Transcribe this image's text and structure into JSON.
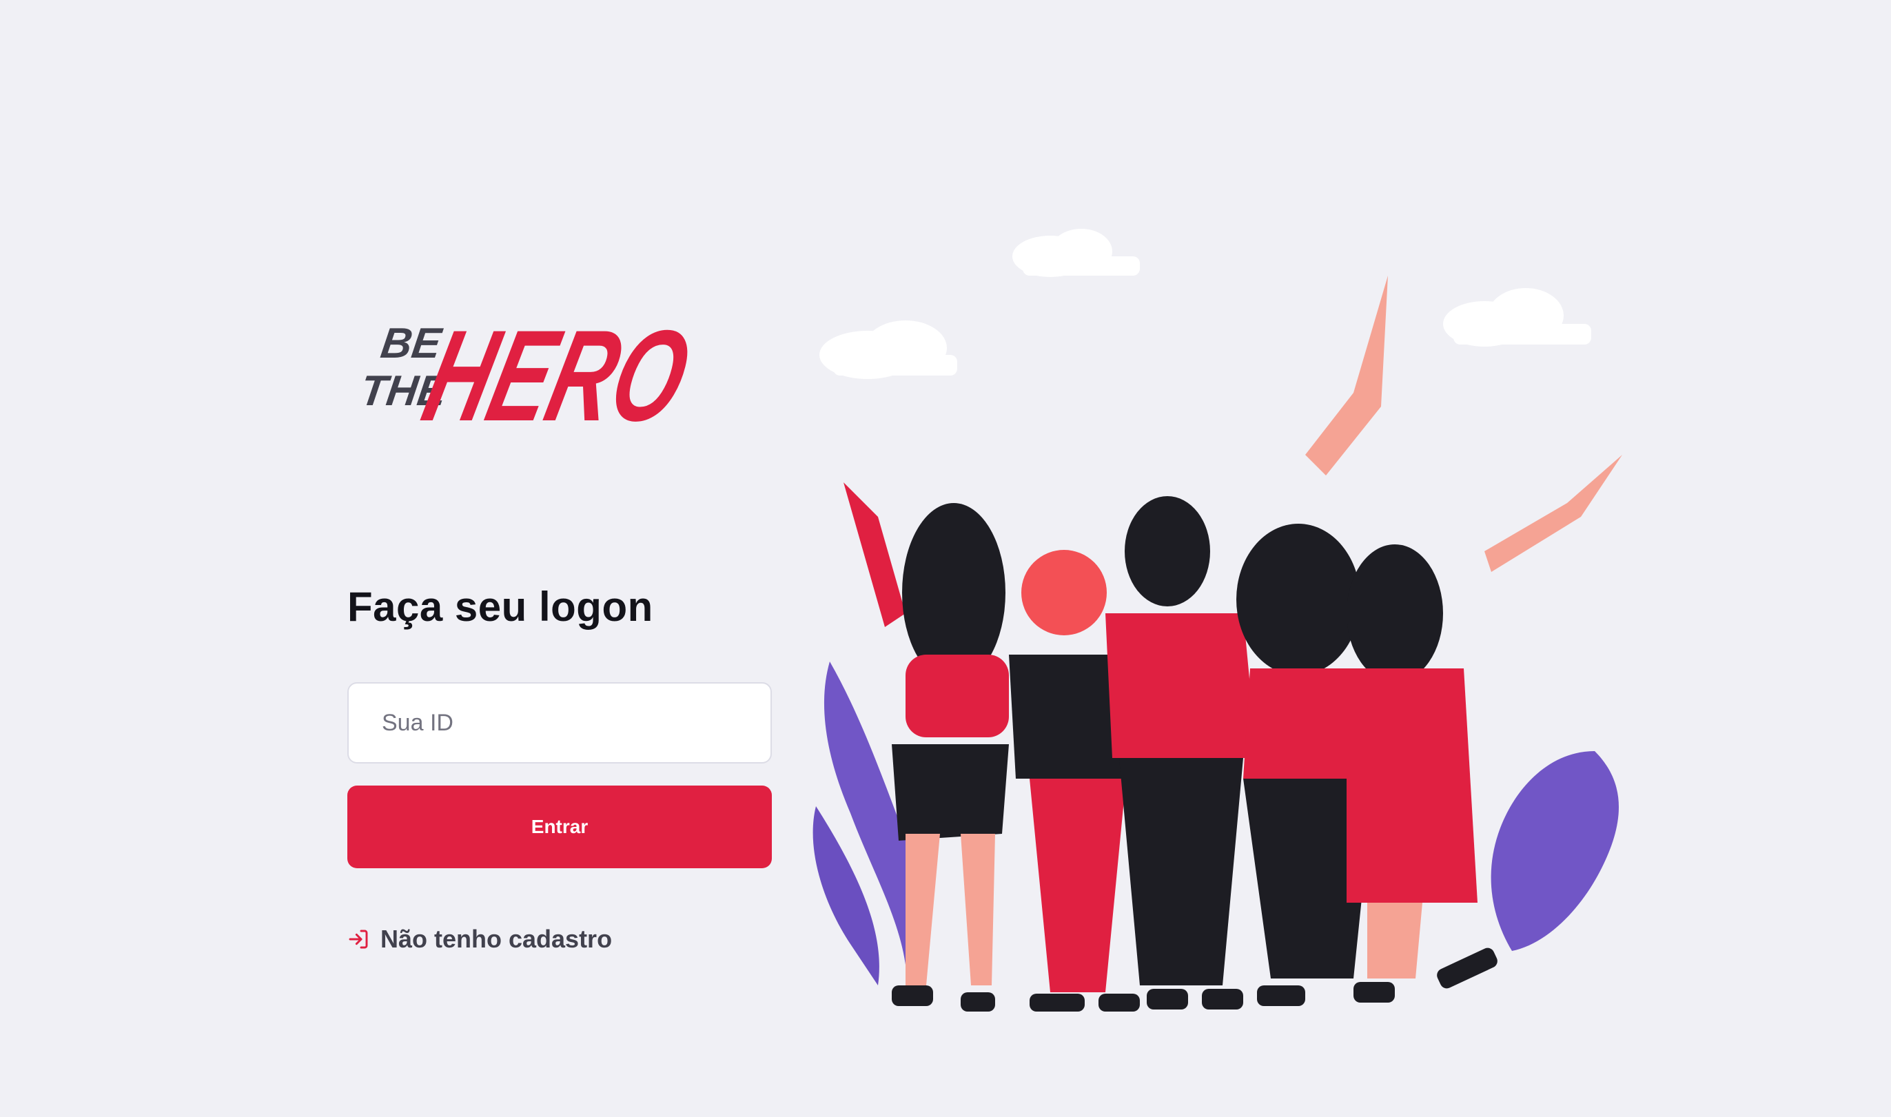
{
  "logo": {
    "be": "BE",
    "the": "THE",
    "hero": "HERO"
  },
  "form": {
    "title": "Faça seu logon",
    "id_placeholder": "Sua ID",
    "submit_label": "Entrar"
  },
  "register_link": {
    "label": "Não tenho cadastro",
    "icon": "log-in-icon"
  },
  "colors": {
    "background": "#f0f0f5",
    "accent": "#e02041",
    "text_dark": "#13131a",
    "text": "#41414d"
  }
}
